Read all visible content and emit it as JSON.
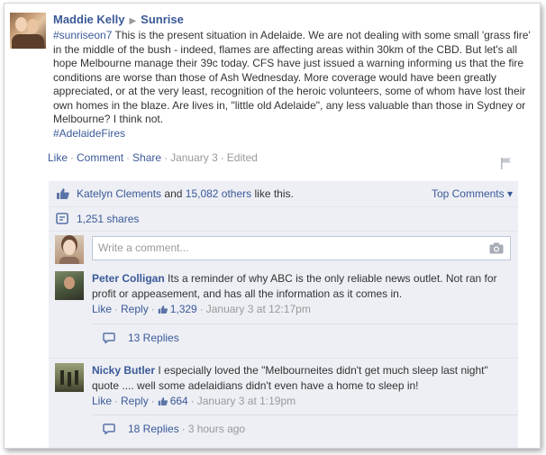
{
  "post": {
    "author": "Maddie Kelly",
    "target": "Sunrise",
    "hashtag_prefix": "#sunriseon7",
    "text": "This is the present situation in Adelaide. We are not dealing with some small 'grass fire' in the middle of the bush - indeed, flames are affecting areas within 30km of the CBD. But let's all hope Melbourne manage their 39c today. CFS have just issued a warning informing us that the fire conditions are worse than those of Ash Wednesday. More coverage would have been greatly appreciated, or at the very least, recognition of the heroic volunteers, some of whom have lost their own homes in the blaze. Are lives in, \"little old Adelaide\", any less valuable than those in Sydney or Melbourne? I think not.",
    "hashtag_suffix": "#AdelaideFires",
    "actions": {
      "like": "Like",
      "comment": "Comment",
      "share": "Share",
      "date": "January 3",
      "edited": "Edited"
    }
  },
  "ufi": {
    "likes": {
      "first_liker": "Katelyn Clements",
      "and": "and",
      "others": "15,082 others",
      "suffix": "like this."
    },
    "top_comments": "Top Comments ▾",
    "shares": "1,251 shares",
    "write_placeholder": "Write a comment..."
  },
  "comments": [
    {
      "author": "Peter Colligan",
      "text": "Its a reminder of why ABC is the only reliable news outlet. Not ran for profit or appeasement, and has all the information as it comes in.",
      "like": "Like",
      "reply": "Reply",
      "like_count": "1,329",
      "time": "January 3 at 12:17pm",
      "replies": "13 Replies",
      "replies_time": ""
    },
    {
      "author": "Nicky Butler",
      "text": "I especially loved the \"Melbourneites didn't get much sleep last night\" quote .... well some adelaidians didn't even have a home to sleep in!",
      "like": "Like",
      "reply": "Reply",
      "like_count": "664",
      "time": "January 3 at 1:19pm",
      "replies": "18 Replies",
      "replies_time": "3 hours ago"
    }
  ],
  "colors": {
    "link": "#3b5998",
    "muted": "#999999",
    "ufi_bg": "#edeff4"
  },
  "icons": [
    "flag-icon",
    "thumbs-up-icon",
    "share-icon",
    "camera-icon",
    "reply-icon"
  ]
}
